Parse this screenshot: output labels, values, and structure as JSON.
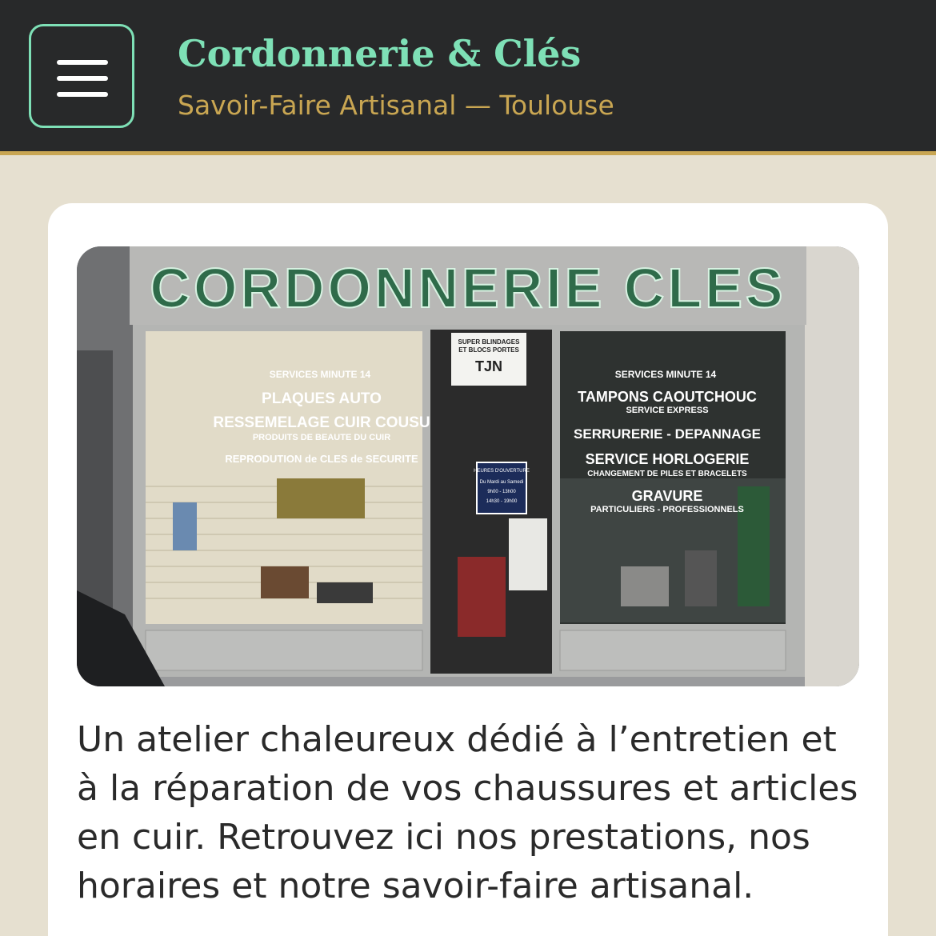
{
  "header": {
    "menu_icon": "hamburger-menu-icon",
    "title": "Cordonnerie & Clés",
    "subtitle": "Savoir-Faire Artisanal — Toulouse",
    "colors": {
      "background": "#28292a",
      "accent_green": "#7ee0b6",
      "accent_gold": "#c9a652"
    }
  },
  "photo": {
    "sign": "CORDONNERIE CLES",
    "left_window": [
      "SERVICES MINUTE 14",
      "PLAQUES AUTO",
      "RESSEMELAGE CUIR COUSU",
      "PRODUITS DE BEAUTE DU CUIR",
      "REPRODUTION de CLES de SECURITE"
    ],
    "right_window": [
      "SERVICES MINUTE 14",
      "TAMPONS CAOUTCHOUC",
      "SERVICE EXPRESS",
      "SERRURERIE - DEPANNAGE",
      "SERVICE HORLOGERIE",
      "CHANGEMENT DE PILES ET BRACELETS",
      "GRAVURE",
      "PARTICULIERS - PROFESSIONNELS"
    ],
    "door_top": [
      "SUPER BLINDAGES",
      "ET BLOCS PORTES",
      "TJN"
    ],
    "door_hours": [
      "HEURES D'OUVERTURE",
      "Du Mardi au Samedi",
      "9h00 - 13h00",
      "14h30 - 19h00"
    ]
  },
  "intro_text": "Un atelier chaleureux dédié à l’entretien et à la réparation de vos chaussures et articles en cuir. Retrouvez ici nos prestations, nos horaires et notre savoir-faire artisanal."
}
